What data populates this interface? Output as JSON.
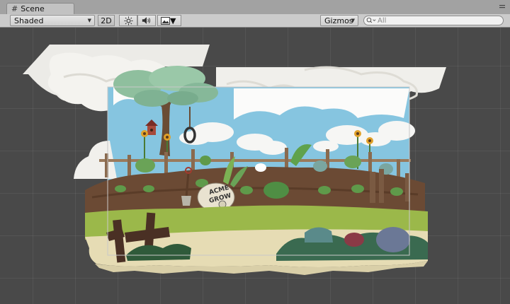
{
  "tab": {
    "icon": "grid-icon",
    "title": "Scene"
  },
  "toolbar": {
    "shading_mode": "Shaded",
    "mode_2d": "2D",
    "lighting_icon": "sun-icon",
    "audio_icon": "speaker-icon",
    "effects_icon": "image-icon",
    "gizmos_label": "Gizmos",
    "search_placeholder": "All"
  },
  "scene": {
    "sign_text_line1": "ACME",
    "sign_text_line2": "GROW"
  },
  "colors": {
    "scene_bg": "#494949",
    "sky": "#86c5e0",
    "soil": "#6b4a34",
    "grass": "#9bb84a",
    "path": "#e6dcb4"
  }
}
